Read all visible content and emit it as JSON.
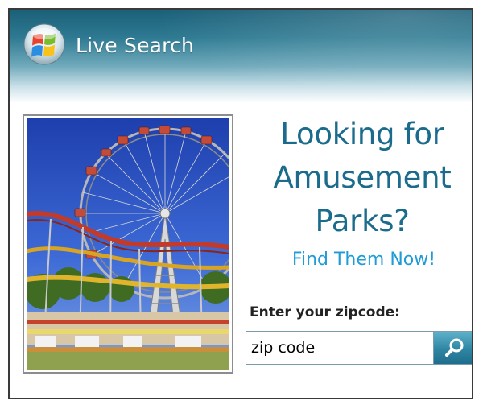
{
  "brand": {
    "name": "Live Search",
    "logo_icon": "windows-flag-orb-icon"
  },
  "photo": {
    "subject": "ferris-wheel-roller-coaster-photo"
  },
  "headline": {
    "line1": "Looking for",
    "line2": "Amusement",
    "line3": "Parks?"
  },
  "cta": {
    "label": "Find Them Now!"
  },
  "zip": {
    "label": "Enter your zipcode:",
    "value": "zip code",
    "search_icon": "magnifier-icon"
  },
  "colors": {
    "header_dark": "#1b5f78",
    "headline": "#1a6b8c",
    "link": "#1f9bd8",
    "search_button": "#2f86a3"
  }
}
